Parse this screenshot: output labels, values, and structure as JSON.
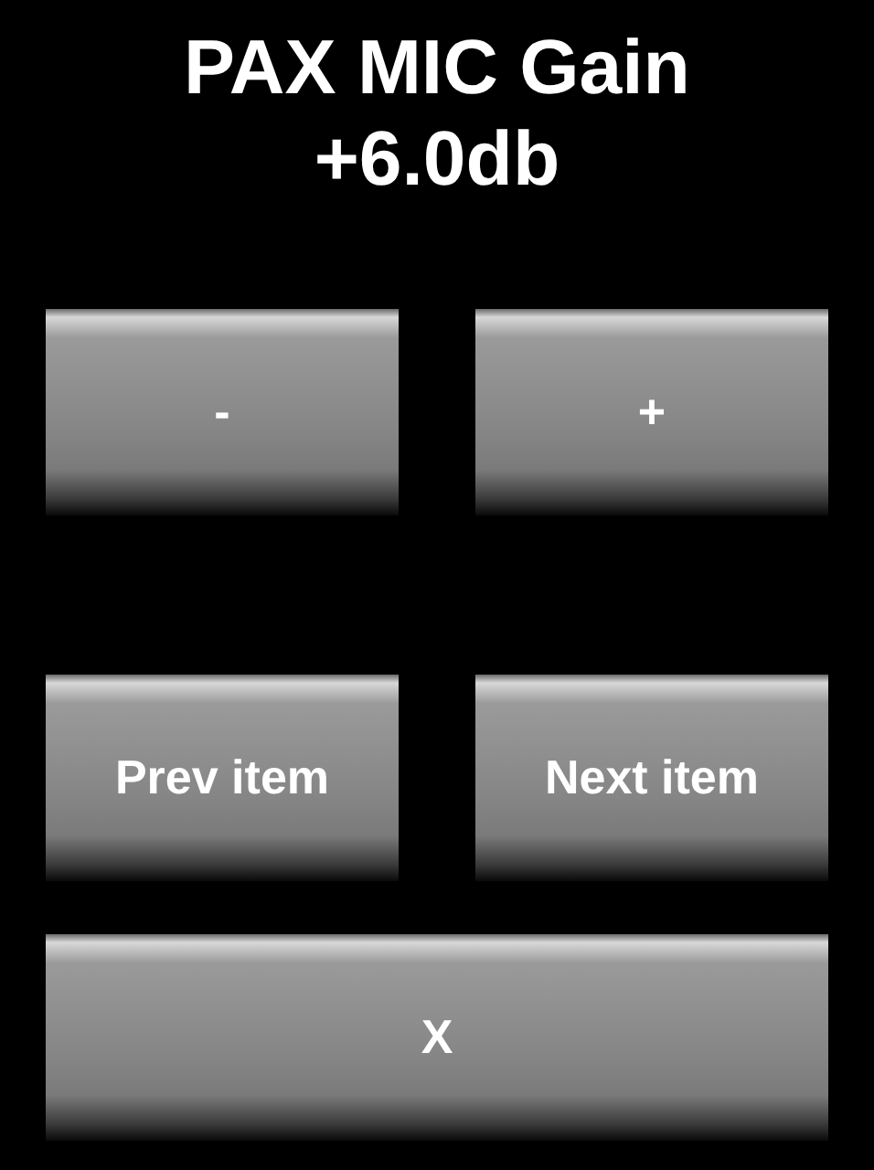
{
  "title": [
    "PAX MIC Gain",
    "+6.0db"
  ],
  "button_rows": [
    {
      "buttons": [
        {
          "label": "-"
        },
        {
          "label": "+"
        }
      ]
    },
    {
      "buttons": [
        {
          "label": "Prev item"
        },
        {
          "label": "Next item"
        }
      ]
    },
    {
      "buttons": [
        {
          "label": "X"
        }
      ]
    }
  ]
}
